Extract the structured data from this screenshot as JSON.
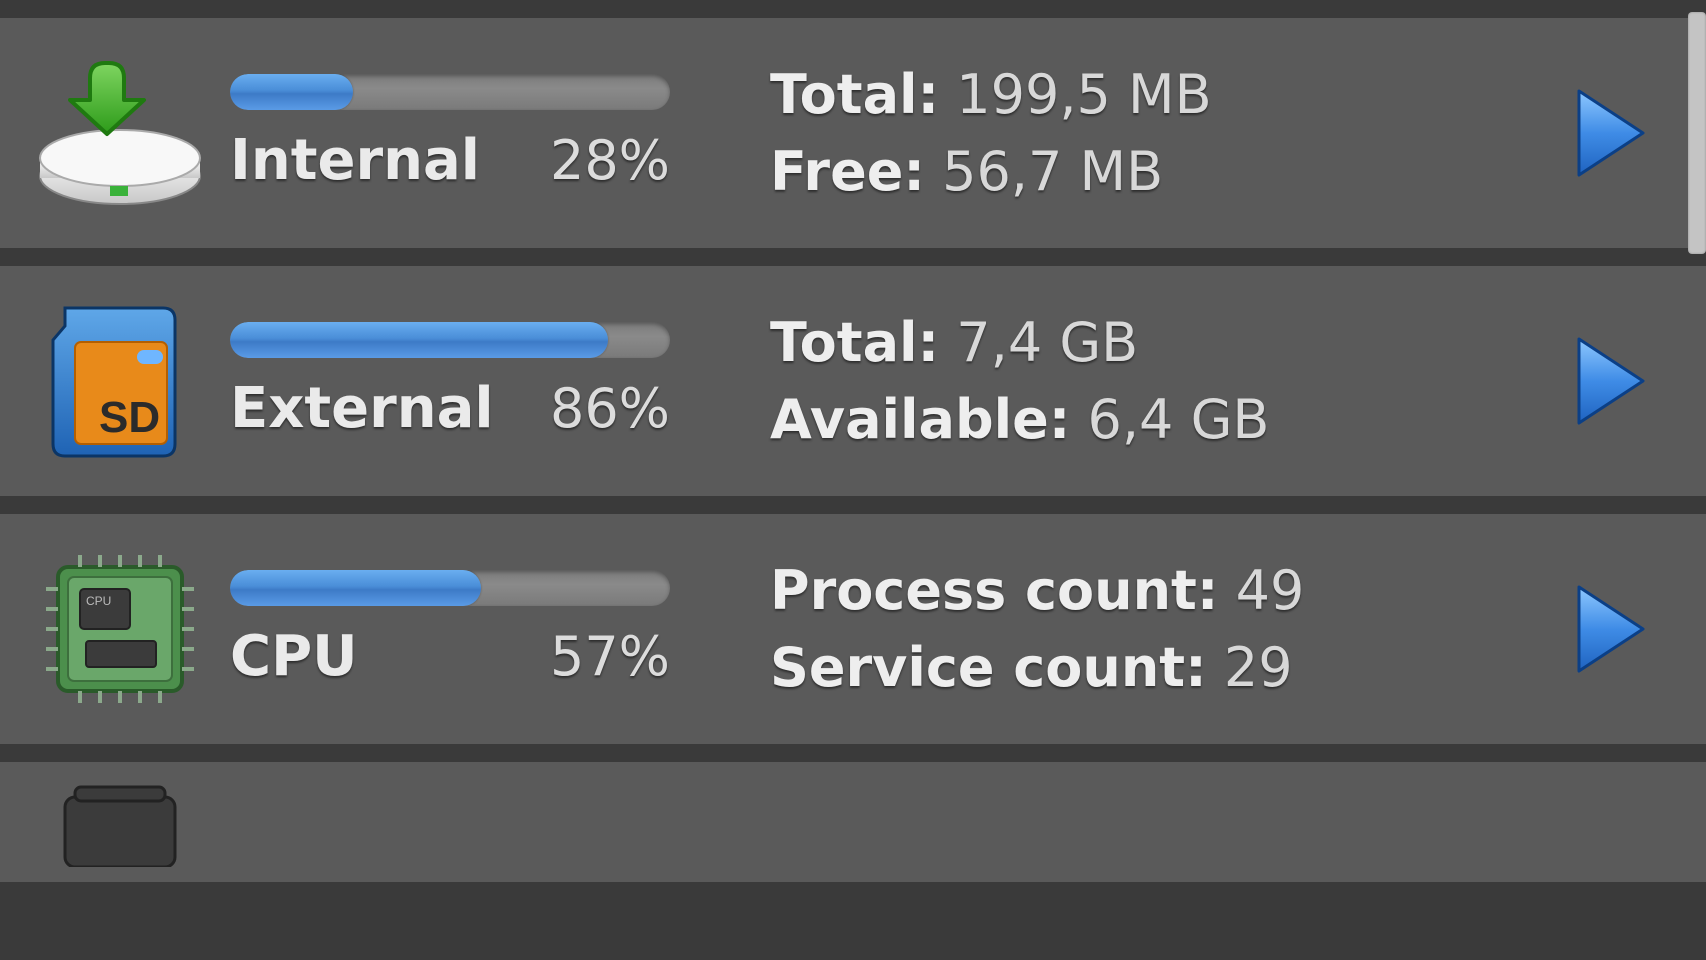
{
  "rows": [
    {
      "name": "Internal",
      "pct": "28%",
      "pct_val": 28,
      "stat1_label": "Total:",
      "stat1_value": "199,5 MB",
      "stat2_label": "Free:",
      "stat2_value": "56,7 MB",
      "icon": "hdd-install-icon"
    },
    {
      "name": "External",
      "pct": "86%",
      "pct_val": 86,
      "stat1_label": "Total:",
      "stat1_value": "7,4 GB",
      "stat2_label": "Available:",
      "stat2_value": "6,4 GB",
      "icon": "sd-card-icon"
    },
    {
      "name": "CPU",
      "pct": "57%",
      "pct_val": 57,
      "stat1_label": "Process count:",
      "stat1_value": "49",
      "stat2_label": "Service count:",
      "stat2_value": "29",
      "icon": "cpu-chip-icon"
    }
  ]
}
